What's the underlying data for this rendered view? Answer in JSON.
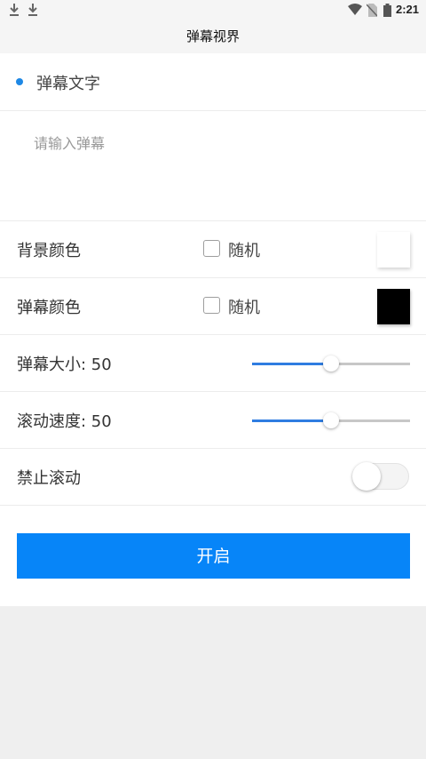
{
  "status_bar": {
    "time": "2:21",
    "left_icons": [
      "download-icon",
      "download-icon"
    ],
    "right_icons": [
      "wifi-icon",
      "no-sim-icon",
      "battery-icon"
    ]
  },
  "header": {
    "title": "弹幕视界"
  },
  "section": {
    "title": "弹幕文字",
    "accent_color": "#1e88e5"
  },
  "input": {
    "value": "",
    "placeholder": "请输入弹幕"
  },
  "settings": {
    "bg_color": {
      "label": "背景颜色",
      "random_label": "随机",
      "random_checked": false,
      "color": "#ffffff"
    },
    "text_color": {
      "label": "弹幕颜色",
      "random_label": "随机",
      "random_checked": false,
      "color": "#000000"
    },
    "size": {
      "label": "弹幕大小: 50",
      "value": 50,
      "max": 100
    },
    "speed": {
      "label": "滚动速度: 50",
      "value": 50,
      "max": 100
    },
    "stop_scroll": {
      "label": "禁止滚动",
      "on": false
    }
  },
  "action": {
    "start_label": "开启",
    "color": "#0785f8"
  }
}
